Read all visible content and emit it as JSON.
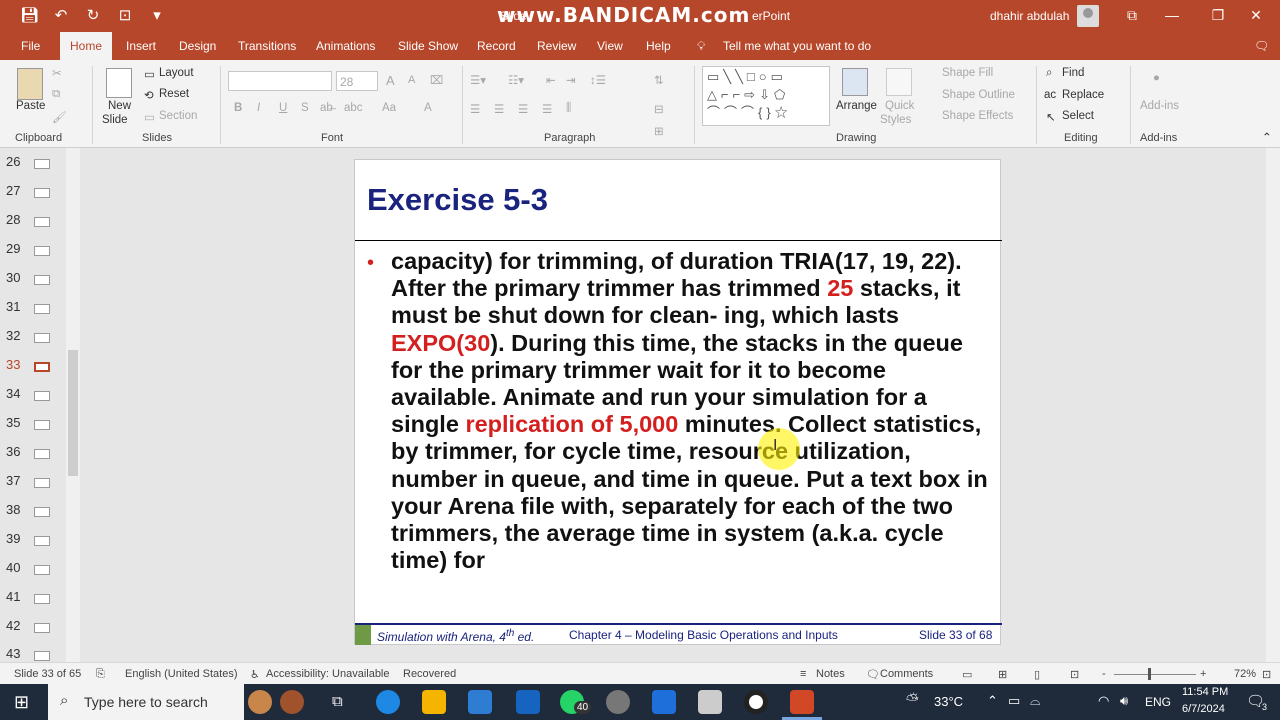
{
  "title_bar": {
    "doc_title": "Slide",
    "watermark": "www.BANDICAM.com",
    "watermark_tail": "erPoint",
    "user": "dhahir abdulah"
  },
  "tabs": [
    "File",
    "Home",
    "Insert",
    "Design",
    "Transitions",
    "Animations",
    "Slide Show",
    "Record",
    "Review",
    "View",
    "Help"
  ],
  "tell_me": "Tell me what you want to do",
  "ribbon": {
    "clipboard": {
      "paste": "Paste",
      "label": "Clipboard"
    },
    "slides": {
      "new_slide": "New",
      "new_slide2": "Slide",
      "layout": "Layout",
      "reset": "Reset",
      "section": "Section",
      "label": "Slides"
    },
    "font": {
      "size": "28",
      "label": "Font",
      "bold": "B",
      "italic": "I",
      "underline": "U",
      "strike": "S",
      "spacing": "abc",
      "case": "Aa",
      "grow": "A",
      "shrink": "A",
      "color": "A"
    },
    "paragraph": {
      "label": "Paragraph"
    },
    "drawing": {
      "arrange": "Arrange",
      "quick_styles": "Quick",
      "quick_styles2": "Styles",
      "shape_fill": "Shape Fill",
      "shape_outline": "Shape Outline",
      "shape_effects": "Shape Effects",
      "label": "Drawing"
    },
    "editing": {
      "find": "Find",
      "replace": "Replace",
      "select": "Select",
      "label": "Editing"
    },
    "addins": {
      "button": "Add-ins",
      "label": "Add-ins"
    }
  },
  "thumbnails": [
    "26",
    "27",
    "28",
    "29",
    "30",
    "31",
    "32",
    "33",
    "34",
    "35",
    "36",
    "37",
    "38",
    "39",
    "40",
    "41",
    "42",
    "43"
  ],
  "active_thumbnail": "33",
  "slide": {
    "title": "Exercise 5-3",
    "bullet": "•",
    "body_1": "capacity) for trimming, of duration TRIA(17, 19, 22). After the primary trimmer has trimmed ",
    "body_red_1": "25",
    "body_2": " stacks, it must be shut down for clean- ing, which lasts ",
    "body_red_2": "EXPO(30",
    "body_3": "). During this time, the stacks in the queue for the primary trimmer wait for it to become available. Animate and run your simulation for a single ",
    "body_red_3": "replication of 5,000",
    "body_4": " minutes. Collect statistics, by trimmer, for cycle time, resource utilization, number in queue, and time in queue. Put a text box in your Arena file with, separately for each of the two trimmers, the average time in system (a.k.a. cycle time) for",
    "footer_book": "Simulation with Arena, 4",
    "footer_book_sup": "th",
    "footer_book_tail": " ed.",
    "footer_chapter": "Chapter 4 – Modeling Basic Operations and Inputs",
    "footer_slide": "Slide 33 of 68"
  },
  "status": {
    "slide": "Slide 33 of 65",
    "language": "English (United States)",
    "accessibility": "Accessibility: Unavailable",
    "recovered": "Recovered",
    "notes": "Notes",
    "comments": "Comments",
    "zoom": "72%",
    "minus": "-",
    "plus": "+"
  },
  "taskbar": {
    "search_placeholder": "Type here to search",
    "whatsapp_badge": "40",
    "weather": "33°C",
    "lang": "ENG",
    "time": "11:54 PM",
    "date": "6/7/2024",
    "notif": "3"
  },
  "colors": {
    "accent": "#b7472a",
    "title": "#1a237e",
    "red": "#d41f1f"
  }
}
